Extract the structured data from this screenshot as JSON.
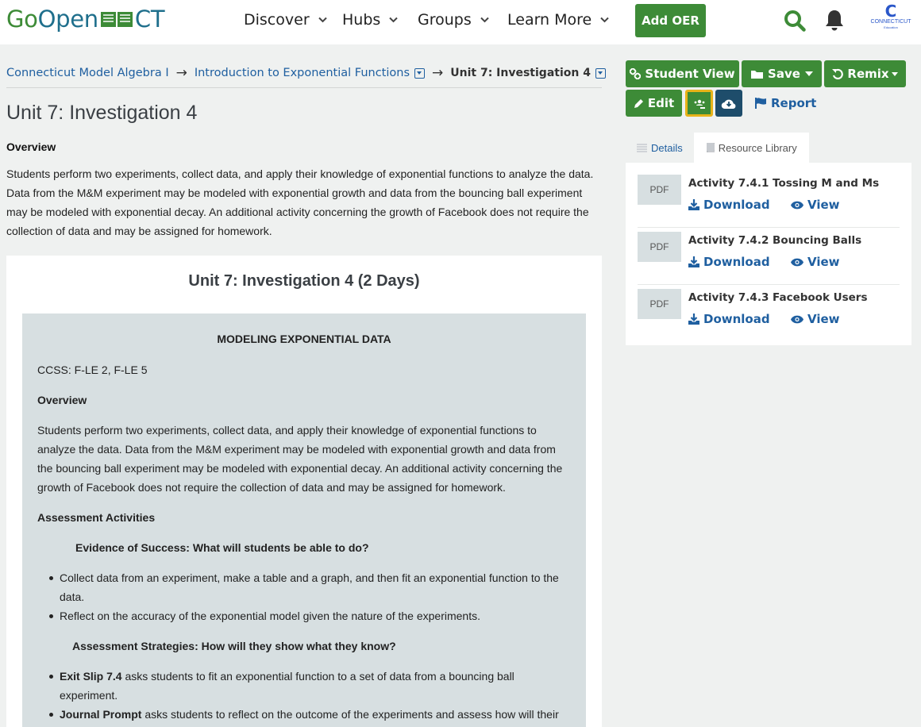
{
  "header": {
    "logo": {
      "go": "Go",
      "open": "Open",
      "ct": "CT"
    },
    "nav": [
      "Discover",
      "Hubs",
      "Groups",
      "Learn More"
    ],
    "add_oer": "Add OER",
    "avatar": {
      "letter": "C",
      "name": "CONNECTICUT",
      "sub": "Education"
    }
  },
  "breadcrumb": {
    "items": [
      "Connecticut Model Algebra I",
      "Introduction to Exponential Functions",
      "Unit 7: Investigation 4"
    ],
    "arrow": "→"
  },
  "main": {
    "title": "Unit 7: Investigation 4",
    "overview_label": "Overview",
    "overview_text": "Students perform two experiments, collect data, and apply their knowledge of exponential functions to analyze the data. Data from the M&M experiment may be modeled with exponential growth and data from the bouncing ball experiment may be modeled with exponential decay.  An additional activity concerning the growth of Facebook does not require the collection of data and may be assigned for homework.",
    "doc": {
      "title": "Unit 7: Investigation 4 (2 Days)",
      "heading": "MODELING EXPONENTIAL DATA",
      "ccss": "CCSS: F-LE 2, F-LE 5",
      "overview_label": "Overview",
      "overview_lines": [
        "Students perform two experiments, collect data, and apply their knowledge of exponential functions to",
        "analyze the data.  Data from the M&M experiment may be modeled with exponential growth and data from",
        "the bouncing ball experiment may be modeled with exponential decay.  An additional activity concerning the",
        "growth of Facebook does not require the collection of data and may be assigned for homework."
      ],
      "assessment_label": "Assessment Activities",
      "evidence_heading": "Evidence of Success:  What will students be able to do?",
      "evidence_bullets": [
        {
          "line1": "Collect data from an experiment, make a table and a graph, and then fit an exponential function to the",
          "line2": "data."
        },
        {
          "line1": "Reflect on the accuracy of the exponential model given the nature of the experiments."
        }
      ],
      "strategies_heading": "Assessment Strategies:  How will they show what they know?",
      "strategy_bullets": [
        {
          "bold": "Exit Slip 7.4",
          "rest": " asks students to fit an exponential function to a set of data from a bouncing ball",
          "line2": "experiment."
        },
        {
          "bold": "Journal Prompt",
          "rest": " asks students to reflect on the outcome of the experiments and assess how will their"
        }
      ]
    }
  },
  "actions": {
    "student_view": "Student View",
    "save": "Save",
    "remix": "Remix",
    "edit": "Edit",
    "report": "Report"
  },
  "sidebar": {
    "tabs": [
      "Details",
      "Resource Library"
    ],
    "resources": [
      {
        "type": "PDF",
        "name": "Activity 7.4.1 Tossing M and Ms",
        "download": "Download",
        "view": "View"
      },
      {
        "type": "PDF",
        "name": "Activity 7.4.2 Bouncing Balls",
        "download": "Download",
        "view": "View"
      },
      {
        "type": "PDF",
        "name": "Activity 7.4.3 Facebook Users",
        "download": "Download",
        "view": "View"
      }
    ]
  },
  "colors": {
    "brand_green": "#3d8b37",
    "navy": "#1e4d6b",
    "link": "#1f5fa0",
    "accent_border": "#e7b319"
  },
  "icons": [
    "book-icon",
    "chevron-down-icon",
    "search-icon",
    "bell-icon",
    "link-icon",
    "folder-icon",
    "undo-icon",
    "pencil-icon",
    "google-classroom-icon",
    "cloud-download-icon",
    "flag-icon",
    "list-icon",
    "book-tab-icon",
    "download-icon",
    "eye-icon"
  ]
}
